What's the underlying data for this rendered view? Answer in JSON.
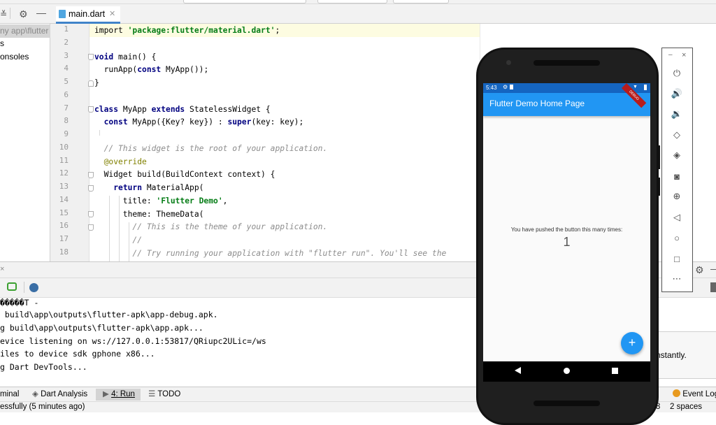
{
  "editor": {
    "tab_label": "main.dart",
    "tab_close": "✕"
  },
  "project_panel": {
    "items": [
      "ny app\\flutter",
      "s",
      "onsoles"
    ]
  },
  "line_numbers": [
    "1",
    "2",
    "3",
    "4",
    "5",
    "6",
    "7",
    "8",
    "9",
    "10",
    "11",
    "12",
    "13",
    "14",
    "15",
    "16",
    "17",
    "18"
  ],
  "code_lines": [
    [
      {
        "t": "import ",
        "c": ""
      },
      {
        "t": "'package:flutter/material.dart'",
        "c": "str"
      },
      {
        "t": ";",
        "c": ""
      }
    ],
    [],
    [
      {
        "t": "void ",
        "c": "kw"
      },
      {
        "t": "main() {",
        "c": ""
      }
    ],
    [
      {
        "t": "  runApp(",
        "c": ""
      },
      {
        "t": "const ",
        "c": "kw"
      },
      {
        "t": "MyApp());",
        "c": ""
      }
    ],
    [
      {
        "t": "}",
        "c": ""
      }
    ],
    [],
    [
      {
        "t": "class ",
        "c": "kw"
      },
      {
        "t": "MyApp ",
        "c": ""
      },
      {
        "t": "extends ",
        "c": "kw"
      },
      {
        "t": "StatelessWidget {",
        "c": ""
      }
    ],
    [
      {
        "t": "  ",
        "c": ""
      },
      {
        "t": "const ",
        "c": "kw"
      },
      {
        "t": "MyApp({Key? key}) : ",
        "c": ""
      },
      {
        "t": "super",
        "c": "kw"
      },
      {
        "t": "(key: key);",
        "c": ""
      }
    ],
    [],
    [
      {
        "t": "  // This widget is the root of your application.",
        "c": "cm"
      }
    ],
    [
      {
        "t": "  @override",
        "c": "ann"
      }
    ],
    [
      {
        "t": "  Widget build(BuildContext context) {",
        "c": ""
      }
    ],
    [
      {
        "t": "    ",
        "c": ""
      },
      {
        "t": "return ",
        "c": "kw"
      },
      {
        "t": "MaterialApp(",
        "c": ""
      }
    ],
    [
      {
        "t": "      title: ",
        "c": ""
      },
      {
        "t": "'Flutter Demo'",
        "c": "str"
      },
      {
        "t": ",",
        "c": ""
      }
    ],
    [
      {
        "t": "      theme: ThemeData(",
        "c": ""
      }
    ],
    [
      {
        "t": "        // This is the theme of your application.",
        "c": "cm"
      }
    ],
    [
      {
        "t": "        //",
        "c": "cm"
      }
    ],
    [
      {
        "t": "        // Try running your application with \"flutter run\". You'll see the",
        "c": "cm"
      }
    ]
  ],
  "console": {
    "lines": [
      "\u0000\u0000\u0000\u0000\u0000T -",
      " build\\app\\outputs\\flutter-apk\\app-debug.apk.",
      "g build\\app\\outputs\\flutter-apk\\app.apk...",
      "evice listening on ws://127.0.0.1:53817/QRiupc2ULic=/ws",
      "iles to device sdk gphone x86...",
      "g Dart DevTools..."
    ],
    "first_line_display": "�����T -"
  },
  "tool_tabs": {
    "terminal": "minal",
    "dart_analysis": "Dart Analysis",
    "run": "4: Run",
    "todo": "TODO",
    "event_log": "Event Log"
  },
  "status": {
    "message": "essfully (5 minutes ago)",
    "encoding_suffix": "-8",
    "indent": "2 spaces"
  },
  "notification": {
    "text": "nstantly."
  },
  "phone": {
    "time": "5:43",
    "app_title": "Flutter Demo Home Page",
    "debug_banner": "DEBUG",
    "counter_label": "You have pushed the button this many times:",
    "counter_value": "1",
    "fab_label": "+"
  },
  "emulator_tools": {
    "minimize": "–",
    "close": "×",
    "buttons": [
      "power",
      "volume-up",
      "volume-down",
      "rotate-left",
      "rotate-right",
      "camera",
      "zoom",
      "back",
      "home",
      "overview",
      "more"
    ]
  },
  "colors": {
    "app_bar": "#2196f3",
    "status_bar": "#1565c0",
    "keyword": "#000080",
    "string": "#067d17",
    "comment": "#8c8c8c"
  }
}
